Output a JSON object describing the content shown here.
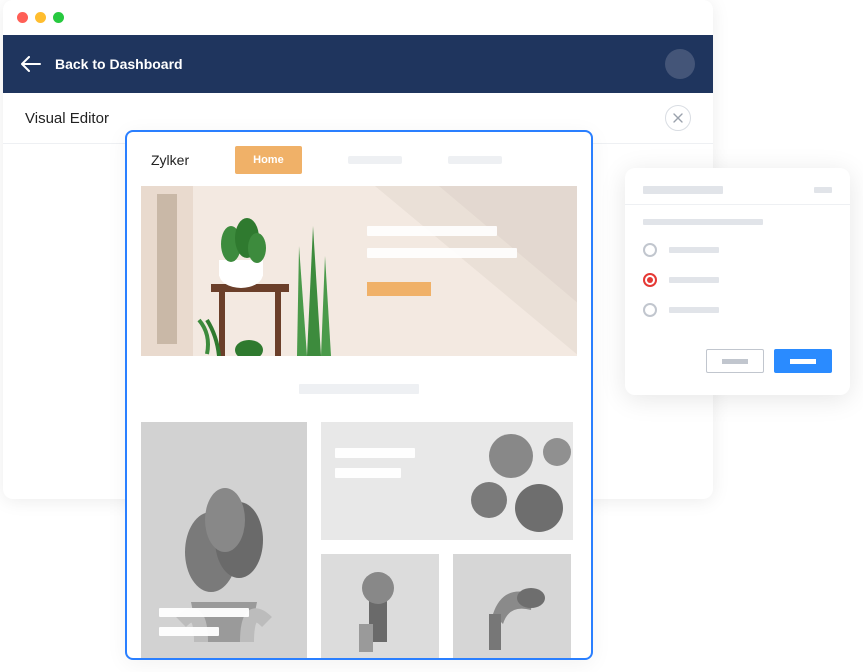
{
  "header": {
    "back_label": "Back to Dashboard"
  },
  "subheader": {
    "title": "Visual Editor"
  },
  "site": {
    "brand": "Zylker",
    "nav_active_label": "Home"
  },
  "modal": {
    "options": [
      {
        "selected": false
      },
      {
        "selected": true
      },
      {
        "selected": false
      }
    ]
  },
  "colors": {
    "selection": "#2a7fff",
    "radio_selected": "#e53935",
    "accent": "#f0b168",
    "primary_button": "#2a8bff",
    "topbar": "#1f355e"
  }
}
